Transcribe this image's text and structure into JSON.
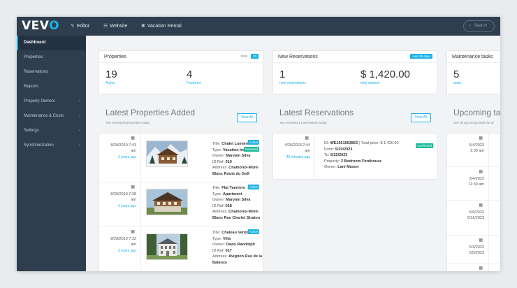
{
  "topbar": {
    "logo_main": "VEV",
    "logo_accent": "O",
    "nav": [
      {
        "label": "Editor",
        "icon": "✎"
      },
      {
        "label": "Website",
        "icon": "☰"
      },
      {
        "label": "Vacation Rental",
        "icon": "✱"
      }
    ],
    "search_placeholder": "Search",
    "search_icon": "⌕"
  },
  "sidebar": {
    "items": [
      {
        "label": "Dashboard",
        "active": true,
        "chev": ""
      },
      {
        "label": "Properties",
        "chev": ""
      },
      {
        "label": "Reservations",
        "chev": ""
      },
      {
        "label": "Reports",
        "chev": ""
      },
      {
        "label": "Property Owners",
        "chev": "‹"
      },
      {
        "label": "Maintenance & Costs",
        "chev": "‹"
      },
      {
        "label": "Settings",
        "chev": "‹"
      },
      {
        "label": "Synchronization",
        "chev": "‹"
      }
    ]
  },
  "properties_card": {
    "title": "Properties",
    "total_label": "total",
    "total_badge": "23",
    "stat1_value": "19",
    "stat1_label": "Active",
    "stat2_value": "4",
    "stat2_label": "Featured"
  },
  "reservations_card": {
    "title": "New Reservations",
    "badge": "Last 30 days",
    "stat1_value": "1",
    "stat1_label": "new reservations",
    "stat2_value": "$ 1,420.00",
    "stat2_label": "total amount"
  },
  "maintenance_card": {
    "title": "Maintenance tasks",
    "stat1_value": "5",
    "stat1_label": "tasks"
  },
  "latest_properties": {
    "title": "Latest Properties Added",
    "sub_pre": "You received ",
    "sub_count": "0",
    "sub_post": " properties today",
    "view_all": "View All",
    "calendar_icon": "▦",
    "rows": [
      {
        "date": "8/29/2019 7:43",
        "time": "am",
        "ago": "3 years ago",
        "title": "Chalet Lumiere",
        "type": "Vacation house",
        "owner": "Maryam Silva",
        "id_ref": "019",
        "address": "Chamonix-Mont-Blanc Route du Golf",
        "tags": [
          "Active",
          "Featured"
        ]
      },
      {
        "date": "8/29/2019 7:38",
        "time": "am",
        "ago": "3 years ago",
        "title": "Flat Tanniere",
        "type": "Apartment",
        "owner": "Maryam Silva",
        "id_ref": "018",
        "address": "Chamonix-Mont-Blanc Rue Charlet Straton",
        "tags": [
          "Active"
        ]
      },
      {
        "date": "8/29/2019 7:32",
        "time": "am",
        "ago": "3 years ago",
        "title": "Chateau Ventoux",
        "type": "Villa",
        "owner": "Davis Randolph",
        "id_ref": "017",
        "address": "Avignon Rue de la Balance",
        "tags": [
          "Active"
        ]
      }
    ],
    "labels": {
      "title": "Title: ",
      "type": "Type: ",
      "owner": "Owner: ",
      "id_ref": "ID Ref: ",
      "address": "Address: "
    }
  },
  "latest_reservations": {
    "title": "Latest Reservations",
    "sub_pre": "You received ",
    "sub_count": "1",
    "sub_post": " reservations today",
    "view_all": "View All",
    "row": {
      "date": "4/26/2023 2:44",
      "time": "am",
      "ago": "48 minutes ago",
      "id": "WE1651563853",
      "total_text": " | Total price: $ 1,420.00",
      "from": "5/20/2023",
      "to": "5/22/2023",
      "property": "3 Bedroom Penthouse",
      "owner": "Lani Mason",
      "tag": "Confirmed"
    },
    "labels": {
      "id": "ID: ",
      "from": "From: ",
      "to": "To: ",
      "property": "Property: ",
      "owner": "Owner: "
    }
  },
  "upcoming_tasks": {
    "title": "Upcoming tas",
    "sub": "See all upcoming tasks for al",
    "rows": [
      {
        "line1": "5/4/2023",
        "line2": "9:30 am"
      },
      {
        "line1": "5/4/2023",
        "line2": "11:30 am"
      },
      {
        "line1": "5/9/2023",
        "line2": "5/11/2023"
      },
      {
        "line1": "5/3/2023",
        "line2": "5/5/2023"
      },
      {
        "line1": "",
        "line2": ""
      }
    ]
  }
}
